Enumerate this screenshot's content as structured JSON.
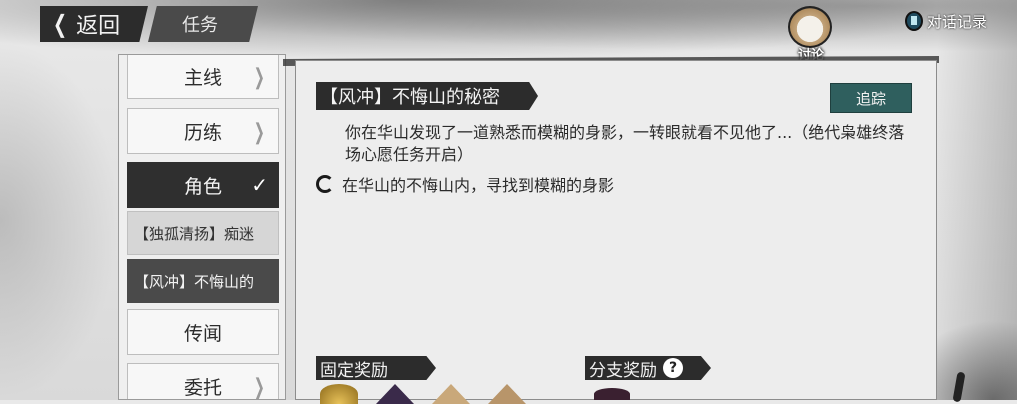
{
  "header": {
    "back_label": "返回",
    "section_title": "任务",
    "discuss_label": "讨论",
    "dialog_log_label": "对话记录"
  },
  "menu": {
    "items": [
      {
        "label": "主线",
        "state": "collapsed"
      },
      {
        "label": "历练",
        "state": "collapsed"
      },
      {
        "label": "角色",
        "state": "expanded"
      },
      {
        "label": "传闻",
        "state": "collapsed"
      },
      {
        "label": "委托",
        "state": "collapsed"
      }
    ],
    "sub_items": [
      {
        "label": "【独孤清扬】痴迷"
      },
      {
        "label": "【风冲】不悔山的",
        "selected": true
      }
    ]
  },
  "quest": {
    "title": "【风冲】不悔山的秘密",
    "track_label": "追踪",
    "description": "你在华山发现了一道熟悉而模糊的身影，一转眼就看不见他了...（绝代枭雄终落场心愿任务开启）",
    "objective": "在华山的不悔山内，寻找到模糊的身影",
    "fixed_reward_label": "固定奖励",
    "branch_reward_label": "分支奖励",
    "help_symbol": "?"
  },
  "colors": {
    "track_button": "#2f5f5e",
    "dark_ink": "#2c2c2c",
    "panel_bg": "#ededed"
  }
}
